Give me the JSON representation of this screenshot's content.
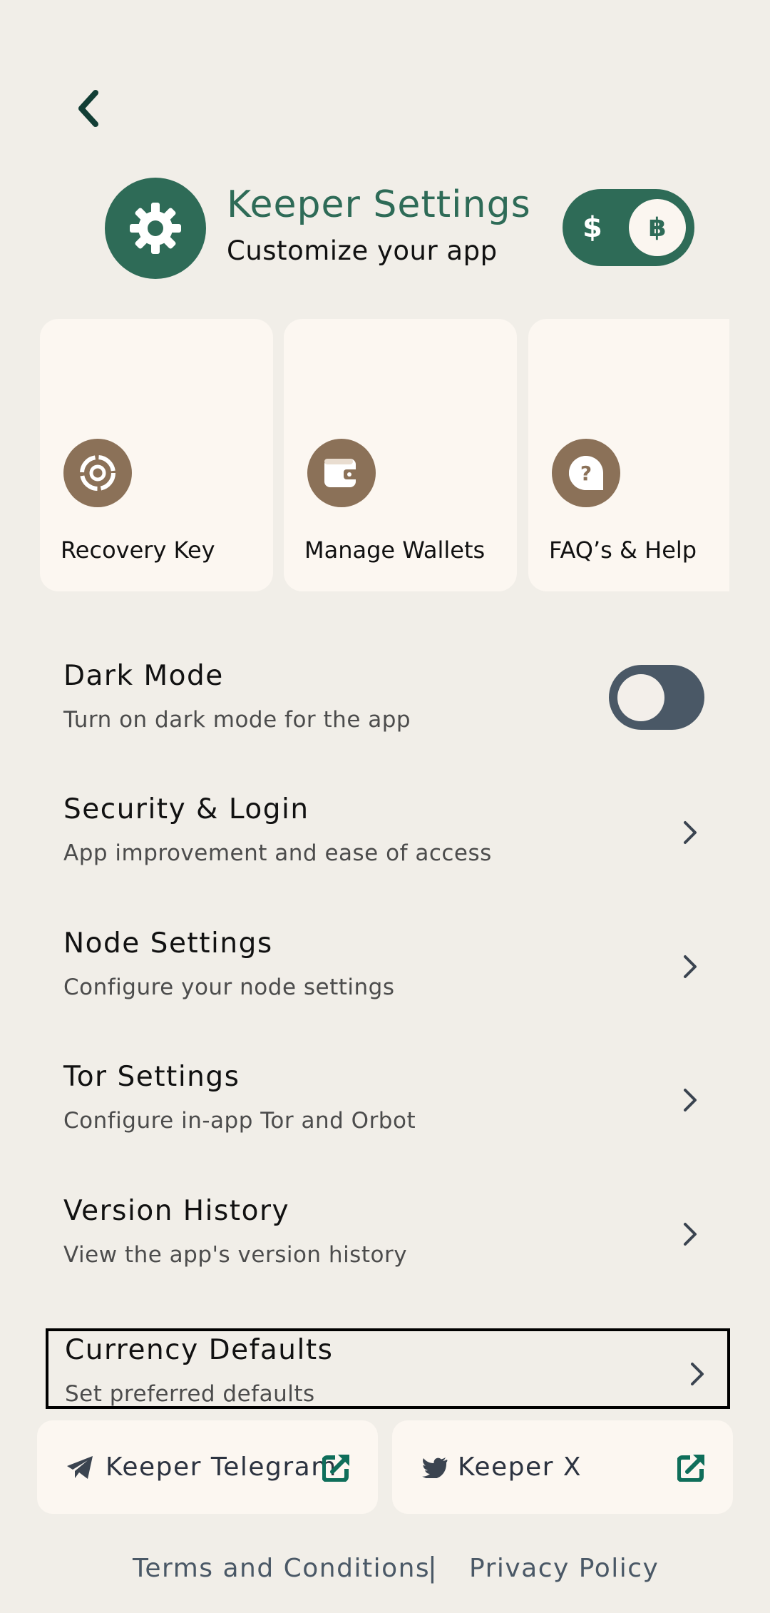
{
  "header": {
    "title": "Keeper Settings",
    "subtitle": "Customize your app",
    "icon": "gear-icon",
    "currency_toggle": {
      "left_symbol": "$",
      "right_symbol": "฿",
      "selected": "฿"
    }
  },
  "cards": [
    {
      "label": "Recovery Key",
      "icon": "recovery-key-icon"
    },
    {
      "label": "Manage Wallets",
      "icon": "wallet-icon"
    },
    {
      "label": "FAQ’s & Help",
      "icon": "help-icon"
    }
  ],
  "settings": [
    {
      "title": "Dark Mode",
      "subtitle": "Turn on dark mode for the app",
      "control": "toggle",
      "enabled": false
    },
    {
      "title": "Security & Login",
      "subtitle": "App improvement and ease of access",
      "control": "chevron"
    },
    {
      "title": "Node Settings",
      "subtitle": "Configure your node settings",
      "control": "chevron"
    },
    {
      "title": "Tor Settings",
      "subtitle": "Configure in-app Tor and Orbot",
      "control": "chevron"
    },
    {
      "title": "Version History",
      "subtitle": "View the app's version history",
      "control": "chevron"
    },
    {
      "title": "Currency Defaults",
      "subtitle": "Set preferred defaults",
      "control": "chevron"
    }
  ],
  "links": [
    {
      "label": "Keeper Telegram",
      "icon": "telegram-icon"
    },
    {
      "label": "Keeper X",
      "icon": "twitter-icon"
    }
  ],
  "footer": {
    "terms": "Terms and Conditions",
    "separator": "|",
    "privacy": "Privacy Policy"
  },
  "colors": {
    "background": "#F1EEE8",
    "primary_green": "#2E6B57",
    "card_background": "#FCF7F1",
    "icon_brown": "#8B7158",
    "toggle_slate": "#4A5866"
  }
}
